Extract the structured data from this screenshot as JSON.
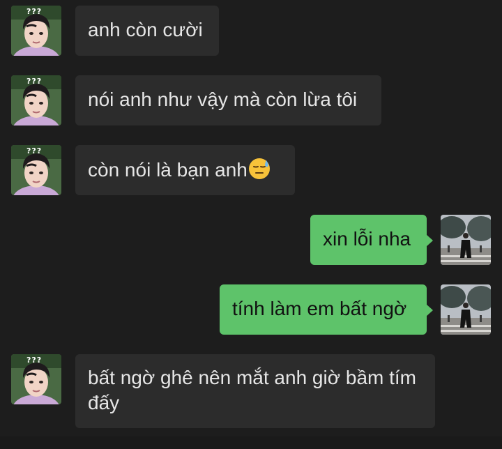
{
  "messages": [
    {
      "side": "incoming",
      "text": "anh còn cười"
    },
    {
      "side": "incoming",
      "text": "nói anh như vậy mà còn lừa tôi"
    },
    {
      "side": "incoming",
      "text": "còn nói là bạn anh",
      "emoji": "downcast-sweat-face-emoji"
    },
    {
      "side": "outgoing",
      "text": "xin lỗi nha"
    },
    {
      "side": "outgoing",
      "text": "tính làm em bất ngờ"
    },
    {
      "side": "incoming",
      "text": "bất ngờ ghê nên mắt anh giờ bầm tím đấy"
    }
  ],
  "avatar_badge": "???",
  "colors": {
    "background": "#1d1d1d",
    "incoming_bubble": "#2c2c2c",
    "outgoing_bubble": "#5ec36a",
    "incoming_text": "#e6e6e6",
    "outgoing_text": "#111111"
  }
}
